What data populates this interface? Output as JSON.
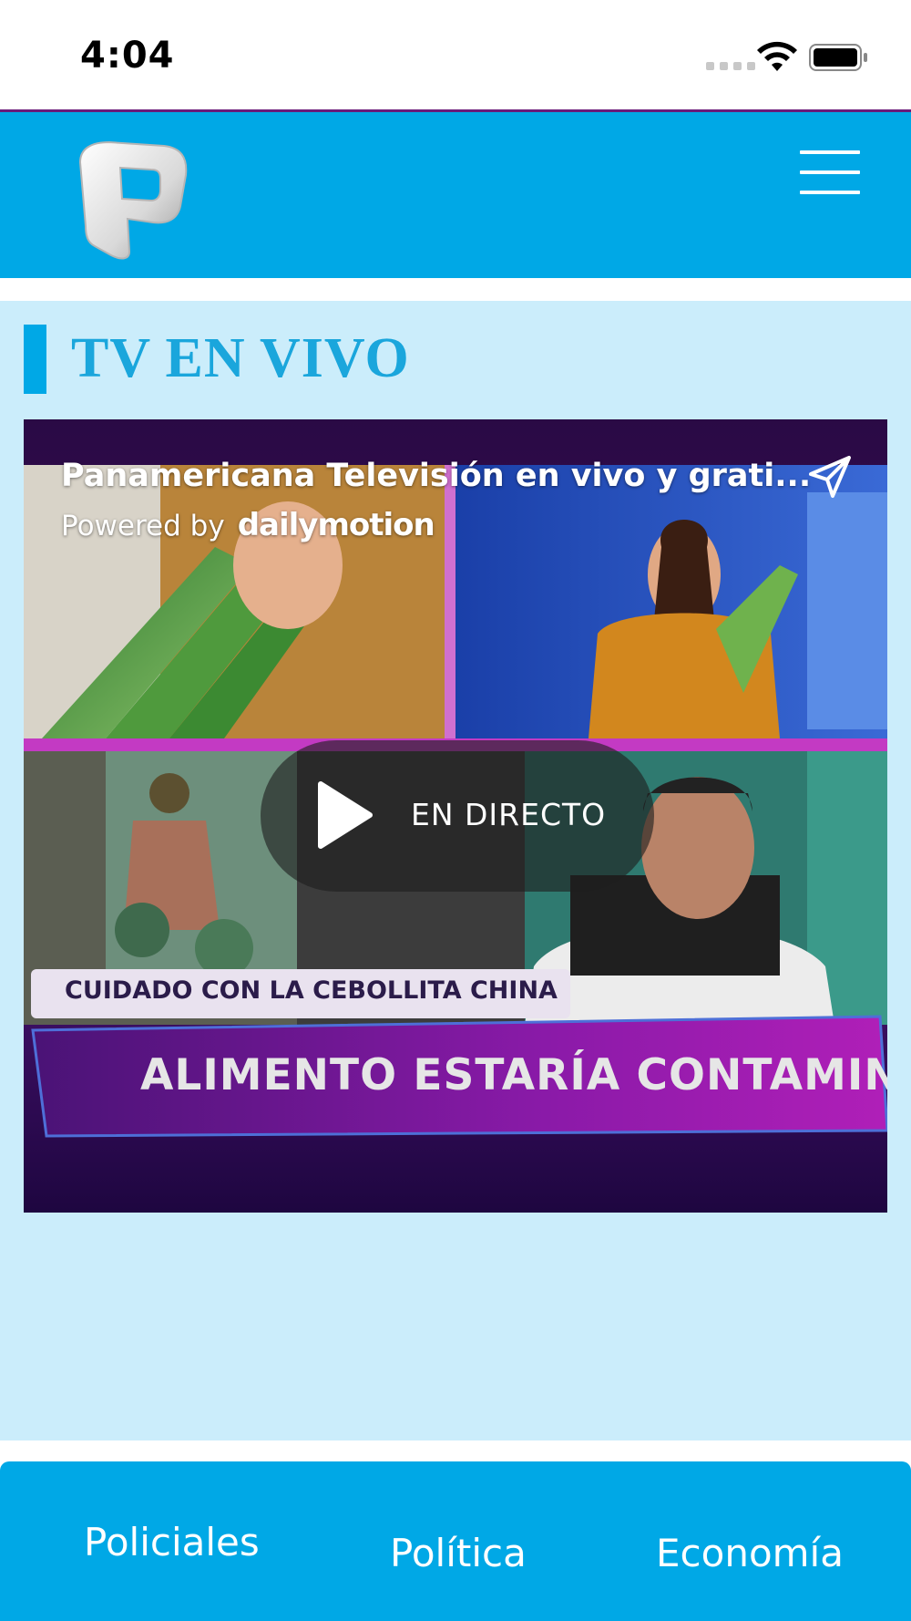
{
  "status_bar": {
    "time": "4:04",
    "icons": [
      "signal-dots-icon",
      "wifi-icon",
      "battery-icon"
    ]
  },
  "header": {
    "logo": "panamericana-p-logo",
    "menu_icon": "hamburger-menu-icon"
  },
  "main": {
    "section_title": "TV EN VIVO",
    "video": {
      "title": "Panamericana Televisión en vivo y grati...",
      "powered_by": "Powered by",
      "brand": "dailymotion",
      "share_icon": "share-send-icon",
      "live_label": "EN DIRECTO",
      "play_icon": "play-icon",
      "caption_chip": "CUIDADO CON LA CEBOLLITA CHINA",
      "headline": "ALIMENTO ESTARÍA CONTAMINA"
    }
  },
  "bottom_nav": {
    "items": [
      {
        "label": "Policiales"
      },
      {
        "label": "Política"
      },
      {
        "label": "Economía"
      }
    ]
  },
  "colors": {
    "header_blue": "#00a8e6",
    "main_background": "#cbedfb",
    "title_blue": "#1aa6dc",
    "header_border": "#6a1b7a",
    "video_purple": "#3a0b5a"
  }
}
